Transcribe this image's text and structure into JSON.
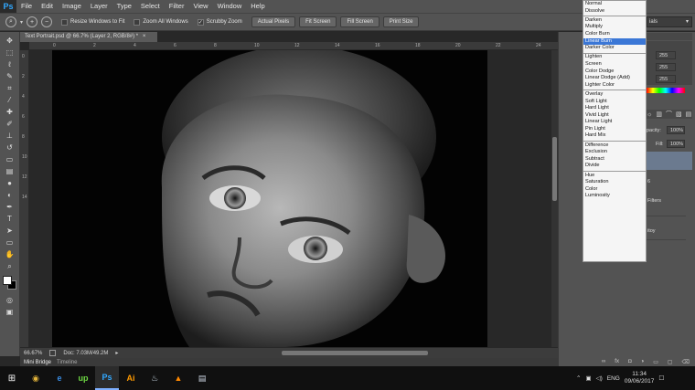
{
  "app": {
    "logo": "Ps",
    "menus": [
      "File",
      "Edit",
      "Image",
      "Layer",
      "Type",
      "Select",
      "Filter",
      "View",
      "Window",
      "Help"
    ]
  },
  "options_bar": {
    "resize_windows": "Resize Windows to Fit",
    "zoom_all": "Zoom All Windows",
    "scrubby_zoom": "Scrubby Zoom",
    "scrubby_checked": "✓",
    "actual_pixels": "Actual Pixels",
    "fit_screen": "Fit Screen",
    "fill_screen": "Fill Screen",
    "print_size": "Print Size",
    "workspace": "ials"
  },
  "document": {
    "tab_title": "Text Portrait.psd @ 66.7% (Layer 2, RGB/8#) *",
    "tab_close": "×",
    "ruler_ticks": [
      "0",
      "2",
      "4",
      "6",
      "8",
      "10",
      "12",
      "14",
      "16",
      "18",
      "20",
      "22",
      "24"
    ],
    "ruler_v_ticks": [
      "0",
      "2",
      "4",
      "6",
      "8",
      "10",
      "12",
      "14"
    ]
  },
  "status": {
    "zoom": "66.67%",
    "doc_info": "Doc: 7.03M/49.2M"
  },
  "bottom_tabs": [
    "Mini Bridge",
    "Timeline"
  ],
  "blend_modes": {
    "groups": [
      [
        "Normal",
        "Dissolve"
      ],
      [
        "Darken",
        "Multiply",
        "Color Burn",
        "Linear Burn",
        "Darker Color"
      ],
      [
        "Lighten",
        "Screen",
        "Color Dodge",
        "Linear Dodge (Add)",
        "Lighter Color"
      ],
      [
        "Overlay",
        "Soft Light",
        "Hard Light",
        "Vivid Light",
        "Linear Light",
        "Pin Light",
        "Hard Mix"
      ],
      [
        "Difference",
        "Exclusion",
        "Subtract",
        "Divide"
      ],
      [
        "Hue",
        "Saturation",
        "Color",
        "Luminosity"
      ]
    ],
    "selected": "Linear Burn"
  },
  "panels": {
    "color_values": [
      "255",
      "255",
      "255"
    ],
    "opacity_label": "pacity:",
    "opacity_value": "100%",
    "fill_label": "Fill:",
    "fill_value": "100%",
    "layer_fragments": [
      "6",
      "Filters",
      "itoy"
    ]
  },
  "taskbar": {
    "apps": [
      "Chrome",
      "Edge",
      "Upwork",
      "Photoshop",
      "Illustrator",
      "Steam",
      "VLC",
      "Notes"
    ],
    "active": "Photoshop",
    "lang": "ENG",
    "time": "11:34",
    "date": "09/06/2017"
  }
}
